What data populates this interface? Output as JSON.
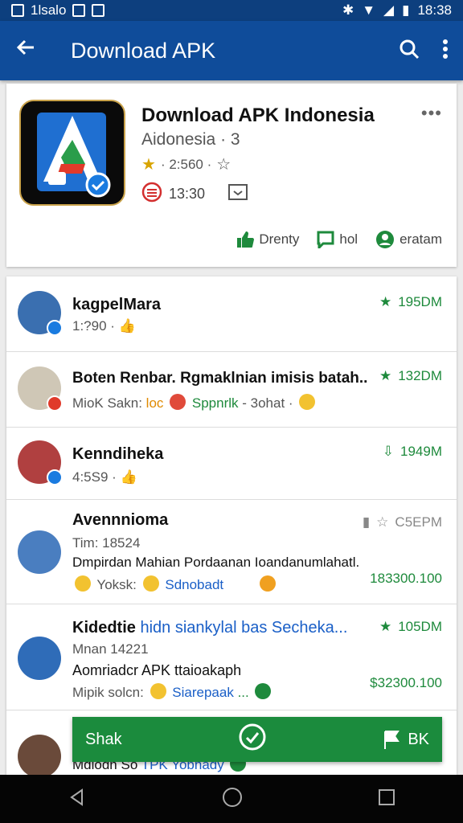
{
  "status_bar": {
    "left_text": "1lsalo",
    "time": "18:38"
  },
  "app_bar": {
    "title": "Download APK"
  },
  "app_card": {
    "name": "Download APK Indonesia",
    "developer": "Aidonesia · 3",
    "rating": "· 2:560 ·",
    "size": "13:30",
    "action_1": "Drenty",
    "action_2": "hol",
    "action_3": "eratam"
  },
  "rows": [
    {
      "name": "kagpelMara",
      "sub": "1:?90 ·",
      "stat": "195DM"
    },
    {
      "name": "Boten Renbar. Rgmaklnian imisis batah..",
      "sub_a": "MioK Sakn:",
      "sub_b": "loc",
      "sub_c": "Sppnrlk",
      "sub_d": "- 3ohat ·",
      "stat": "132DM"
    },
    {
      "name": "Kenndiheka",
      "sub": "4:5S9 ·",
      "stat": "1949M"
    },
    {
      "name": "Avennnioma",
      "sub": "Tim: 18524",
      "line3": "Dmpirdan Mahian Pordaanan Ioandanumlahatl.",
      "sub_a": "Yoksk:",
      "sub_b": "Sdnobadt",
      "stat": "C5EPM",
      "amount": "183300.100"
    },
    {
      "name_a": "Kidedtie",
      "name_b": "hidn siankylal bas Secheka...",
      "sub": "Mnan 14221",
      "line3": "Aomriadcr APK ttaioakaph",
      "sub_a": "Mipik solcn:",
      "sub_b": "Siarepaak",
      "sub_c": "...",
      "stat": "105DM",
      "amount": "$32300.100"
    },
    {
      "sub_a": "Mdlodn So",
      "sub_b": "TPK Yobhady"
    }
  ],
  "snackbar": {
    "label": "Shak",
    "right_label": "BK"
  },
  "colors": {
    "primary": "#0f4c9a",
    "accent": "#1e8a3c",
    "status": "#0d3f7e"
  }
}
